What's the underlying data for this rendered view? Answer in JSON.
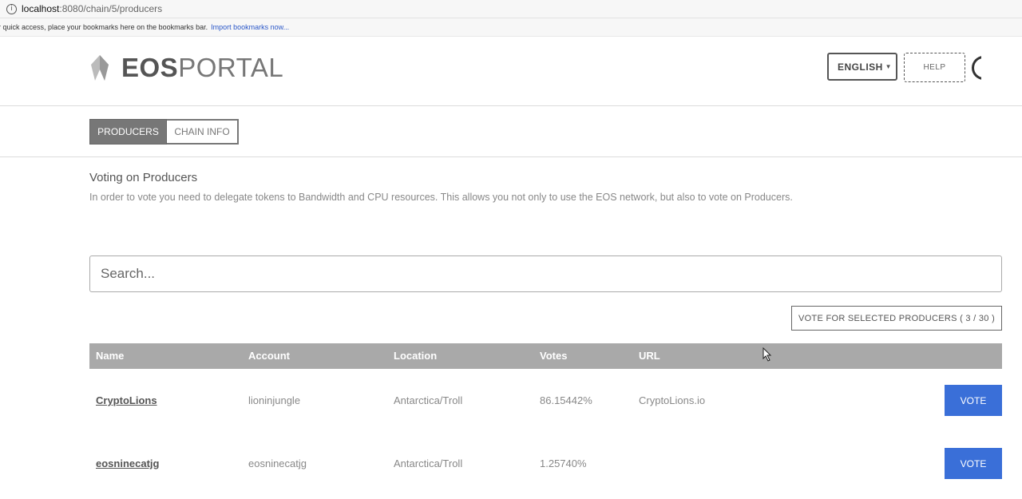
{
  "browser": {
    "url_host": "localhost",
    "url_path": ":8080/chain/5/producers",
    "bookmarks_text": "r quick access, place your bookmarks here on the bookmarks bar.",
    "bookmarks_link": "Import bookmarks now..."
  },
  "header": {
    "logo_bold": "EOS",
    "logo_light": "PORTAL",
    "language": "ENGLISH",
    "help": "HELP"
  },
  "tabs": [
    {
      "label": "PRODUCERS",
      "active": true
    },
    {
      "label": "CHAIN INFO",
      "active": false
    }
  ],
  "section": {
    "title": "Voting on Producers",
    "description": "In order to vote you need to delegate tokens to Bandwidth and CPU resources. This allows you not only to use the EOS network, but also to vote on Producers."
  },
  "search": {
    "placeholder": "Search..."
  },
  "vote_selected_label": "VOTE FOR SELECTED PRODUCERS ( 3 / 30 )",
  "table": {
    "columns": [
      "Name",
      "Account",
      "Location",
      "Votes",
      "URL"
    ],
    "rows": [
      {
        "name": "CryptoLions",
        "account": "lioninjungle",
        "location": "Antarctica/Troll",
        "votes": "86.15442%",
        "url": "CryptoLions.io",
        "action": "VOTE"
      },
      {
        "name": "eosninecatjg",
        "account": "eosninecatjg",
        "location": "Antarctica/Troll",
        "votes": "1.25740%",
        "url": "",
        "action": "VOTE"
      }
    ]
  },
  "colors": {
    "accent": "#3a6fd8",
    "header_gray": "#a9a9a9",
    "tab_active": "#777777"
  }
}
